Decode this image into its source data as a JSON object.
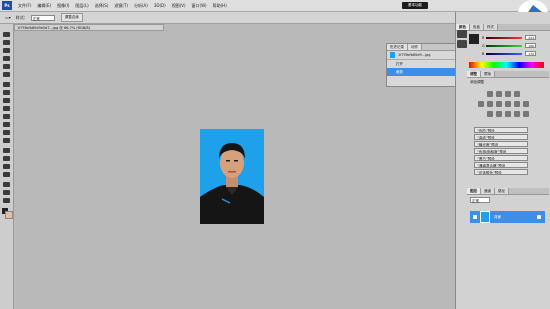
{
  "menubar": {
    "logo": "Ps",
    "items": [
      "文件(F)",
      "编辑(E)",
      "图像(I)",
      "图层(L)",
      "选择(S)",
      "滤镜(T)",
      "分析(A)",
      "3D(D)",
      "视图(V)",
      "窗口(W)",
      "帮助(H)"
    ],
    "workspace_button": "基本功能"
  },
  "options": {
    "style_label": "样式：",
    "style_value": "正常",
    "btn_feather": "调整边缘"
  },
  "document": {
    "tab_title": "1f7f3bfb65d9e5d7...jpg @ 66.7% (RGB/8)"
  },
  "history": {
    "tabs": [
      "历史记录",
      "动作"
    ],
    "snapshot_name": "1f7f3bfb65d9...jpg",
    "steps": [
      "打开",
      "裁剪"
    ]
  },
  "color_panel": {
    "tabs": [
      "颜色",
      "色板",
      "样式"
    ],
    "sliders": [
      {
        "label": "R",
        "value": "224",
        "color": "#e04050"
      },
      {
        "label": "G",
        "value": "190",
        "color": "#40b040"
      },
      {
        "label": "B",
        "value": "172",
        "color": "#4060e0"
      }
    ]
  },
  "adjustments": {
    "tabs": [
      "调整",
      "蒙版"
    ],
    "header": "添加调整",
    "presets": [
      "“色阶”预设",
      "“曲线”预设",
      "“曝光度”预设",
      "“色相/饱和度”预设",
      "“黑白”预设",
      "“通道混合器”预设",
      "“可选颜色”预设"
    ]
  },
  "layers": {
    "tabs": [
      "图层",
      "通道",
      "路径"
    ],
    "blend_mode": "正常",
    "layer_name": "背景"
  }
}
